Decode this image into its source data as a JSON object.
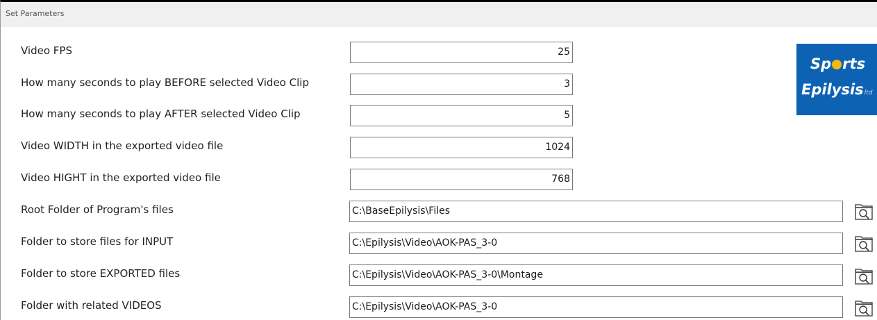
{
  "window": {
    "title": "Set Parameters"
  },
  "logo": {
    "line1_a": "Sp",
    "line1_b": "rts",
    "line2": "Epilysis",
    "suffix": "ltd",
    "background_color": "#0d62b4",
    "ball_color": "#f5b90a"
  },
  "fields": {
    "video_fps": {
      "label": "Video FPS",
      "value": "25"
    },
    "seconds_before": {
      "label": "How many seconds to play BEFORE selected Video Clip",
      "value": "3"
    },
    "seconds_after": {
      "label": "How many seconds to play AFTER selected Video Clip",
      "value": "5"
    },
    "video_width": {
      "label": "Video WIDTH in the exported video file",
      "value": "1024"
    },
    "video_height": {
      "label": "Video HIGHT in the exported video file",
      "value": "768"
    },
    "root_folder": {
      "label": "Root Folder of Program's files",
      "value": "C:\\BaseEpilysis\\Files",
      "browse_icon": "folder-search-icon"
    },
    "input_folder": {
      "label": "Folder to store files for INPUT",
      "value": "C:\\Epilysis\\Video\\AOK-PAS_3-0",
      "browse_icon": "folder-search-icon"
    },
    "exported_folder": {
      "label": "Folder to store EXPORTED files",
      "value": "C:\\Epilysis\\Video\\AOK-PAS_3-0\\Montage",
      "browse_icon": "folder-search-icon"
    },
    "videos_folder": {
      "label": "Folder with related VIDEOS",
      "value": "C:\\Epilysis\\Video\\AOK-PAS_3-0",
      "browse_icon": "folder-search-icon"
    }
  }
}
